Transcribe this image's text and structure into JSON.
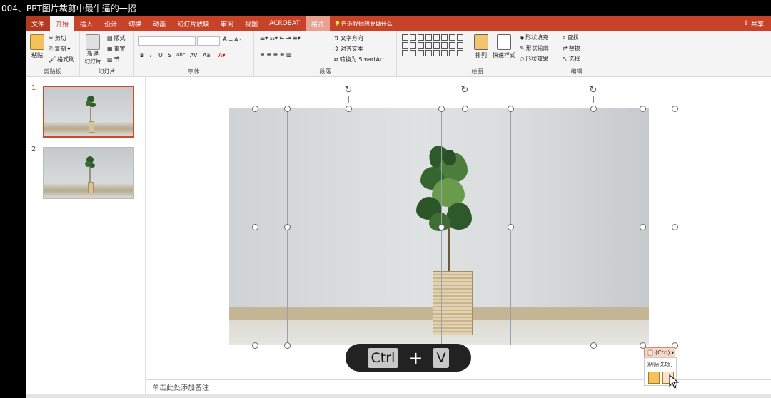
{
  "video_title": "004、PPT图片裁剪中最牛逼的一招",
  "menu": {
    "tabs": [
      "文件",
      "开始",
      "插入",
      "设计",
      "切换",
      "动画",
      "幻灯片放映",
      "审阅",
      "视图",
      "ACROBAT",
      "格式"
    ],
    "active": "开始",
    "tell_me": "告诉我你想要做什么",
    "share": "共享"
  },
  "ribbon": {
    "clipboard": {
      "label": "剪贴板",
      "paste": "粘贴",
      "cut": "剪切",
      "copy": "复制",
      "format_painter": "格式刷"
    },
    "slides": {
      "label": "幻灯片",
      "new_slide": "新建",
      "new_slide2": "幻灯片",
      "layout": "版式",
      "reset": "重置",
      "section": "节"
    },
    "font": {
      "label": "字体"
    },
    "paragraph": {
      "label": "段落",
      "text_direction": "文字方向",
      "align_text": "对齐文本",
      "smartart": "转换为 SmartArt"
    },
    "drawing": {
      "label": "绘图",
      "arrange": "排列",
      "quick_styles": "快速样式",
      "shape_fill": "形状填充",
      "shape_outline": "形状轮廓",
      "shape_effects": "形状效果"
    },
    "editing": {
      "label": "编辑",
      "find": "查找",
      "replace": "替换",
      "select": "选择"
    }
  },
  "slides": [
    {
      "number": "1",
      "selected": true
    },
    {
      "number": "2",
      "selected": false
    }
  ],
  "overlay": {
    "key1": "Ctrl",
    "plus": "+",
    "key2": "V"
  },
  "paste_options": {
    "button": "(Ctrl)",
    "label": "粘贴选项:"
  },
  "notes_placeholder": "单击此处添加备注",
  "colors": {
    "accent": "#c6432a",
    "selection": "#d24726"
  }
}
